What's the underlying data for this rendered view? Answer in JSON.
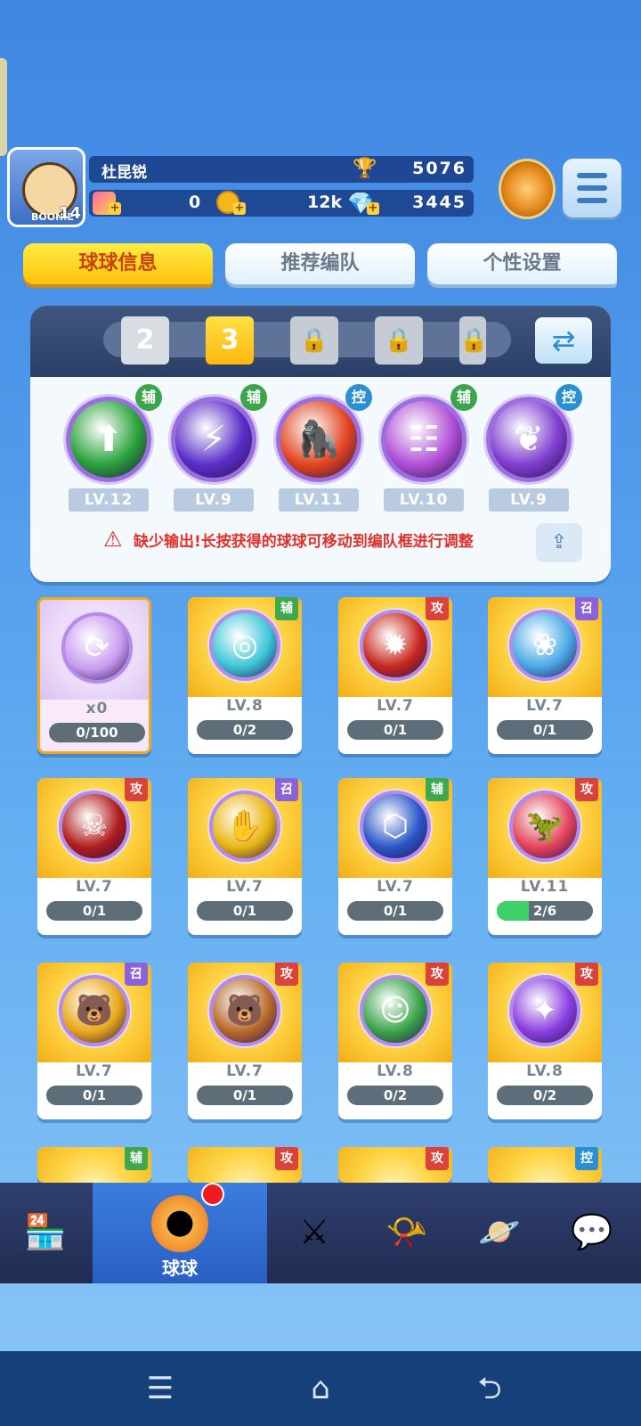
{
  "player": {
    "name": "杜昆锐",
    "level": "14",
    "avatar_tag": "BOONIE",
    "trophies": "5076",
    "cards": "0",
    "coins": "12k",
    "gems": "3445"
  },
  "tabs": [
    "球球信息",
    "推荐编队",
    "个性设置"
  ],
  "lineup": {
    "slots": [
      {
        "label": "2",
        "state": "number"
      },
      {
        "label": "3",
        "state": "active"
      },
      {
        "label": "🔒",
        "state": "locked"
      },
      {
        "label": "🔒",
        "state": "locked"
      },
      {
        "label": "🔒",
        "state": "locked"
      }
    ],
    "balls": [
      {
        "level": "LV.12",
        "tag": "辅",
        "icon": "arrow-up-icon",
        "glyph": "⬆",
        "color": "#29a23a"
      },
      {
        "level": "LV.9",
        "tag": "辅",
        "icon": "lightning-icon",
        "glyph": "⚡",
        "color": "#5a2fc8"
      },
      {
        "level": "LV.11",
        "tag": "控",
        "icon": "gorilla-icon",
        "glyph": "🦍",
        "color": "#e2441e"
      },
      {
        "level": "LV.10",
        "tag": "辅",
        "icon": "crowd-icon",
        "glyph": "☷",
        "color": "#b04fd6"
      },
      {
        "level": "LV.9",
        "tag": "控",
        "icon": "butterfly-icon",
        "glyph": "❦",
        "color": "#7f3fd0"
      }
    ],
    "warning": "缺少输出!长按获得的球球可移动到编队框进行调整"
  },
  "cards": [
    {
      "level": "x0",
      "progress": "0/100",
      "tag": "",
      "icon": "refresh-orb-icon",
      "glyph": "⟳",
      "color": "#c89bf0",
      "fill": 0,
      "special": true
    },
    {
      "level": "LV.8",
      "progress": "0/2",
      "tag": "辅",
      "icon": "swirl-icon",
      "glyph": "◎",
      "color": "#3cc6d8",
      "fill": 0
    },
    {
      "level": "LV.7",
      "progress": "0/1",
      "tag": "攻",
      "icon": "explosion-icon",
      "glyph": "✹",
      "color": "#c8281e",
      "fill": 0
    },
    {
      "level": "LV.7",
      "progress": "0/1",
      "tag": "召",
      "icon": "lotus-icon",
      "glyph": "❀",
      "color": "#4aa8e6",
      "fill": 0
    },
    {
      "level": "LV.7",
      "progress": "0/1",
      "tag": "攻",
      "icon": "venom-icon",
      "glyph": "☠",
      "color": "#b01c1c",
      "fill": 0
    },
    {
      "level": "LV.7",
      "progress": "0/1",
      "tag": "召",
      "icon": "hand-icon",
      "glyph": "✋",
      "color": "#e8b612",
      "fill": 0
    },
    {
      "level": "LV.7",
      "progress": "0/1",
      "tag": "辅",
      "icon": "hexagon-icon",
      "glyph": "⬡",
      "color": "#2a56c8",
      "fill": 0
    },
    {
      "level": "LV.11",
      "progress": "2/6",
      "tag": "攻",
      "icon": "dinosaur-icon",
      "glyph": "🦖",
      "color": "#e2445a",
      "fill": 0.333
    },
    {
      "level": "LV.7",
      "progress": "0/1",
      "tag": "召",
      "icon": "bear-icon",
      "glyph": "🐻",
      "color": "#e8a818",
      "fill": 0
    },
    {
      "level": "LV.7",
      "progress": "0/1",
      "tag": "攻",
      "icon": "bear2-icon",
      "glyph": "🐻",
      "color": "#b86a2a",
      "fill": 0
    },
    {
      "level": "LV.8",
      "progress": "0/2",
      "tag": "攻",
      "icon": "ranger-icon",
      "glyph": "☺",
      "color": "#3aa44a",
      "fill": 0
    },
    {
      "level": "LV.8",
      "progress": "0/2",
      "tag": "攻",
      "icon": "cannon-icon",
      "glyph": "✦",
      "color": "#8a3fe0",
      "fill": 0
    }
  ],
  "partial_row_tags": [
    "辅",
    "攻",
    "攻",
    "控"
  ],
  "nav": [
    {
      "icon": "shop-icon",
      "glyph": "🏪",
      "label": ""
    },
    {
      "icon": "ball-icon",
      "glyph": "●",
      "label": "球球"
    },
    {
      "icon": "swords-icon",
      "glyph": "⚔",
      "label": ""
    },
    {
      "icon": "whistle-icon",
      "glyph": "📯",
      "label": ""
    },
    {
      "icon": "planet-icon",
      "glyph": "🪐",
      "label": ""
    },
    {
      "icon": "chat-icon",
      "glyph": "💬",
      "label": ""
    }
  ],
  "system": {
    "menu": "☰",
    "home": "⌂",
    "back": "⮌"
  },
  "colors": {
    "atk": "#d9433a",
    "sup": "#3da84c",
    "sum": "#8a63d8",
    "ctl": "#2b8fd4"
  }
}
